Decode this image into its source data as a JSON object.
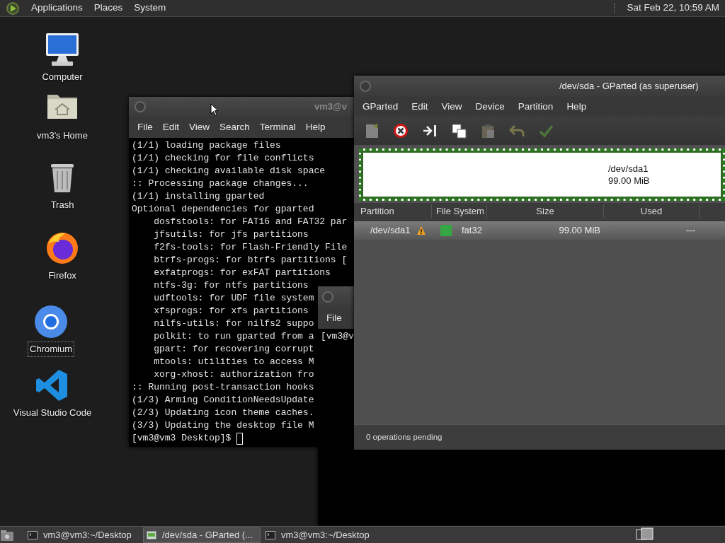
{
  "top_panel": {
    "menus": [
      "Applications",
      "Places",
      "System"
    ],
    "clock": "Sat Feb 22, 10:59 AM"
  },
  "desktop_icons": [
    {
      "label": "Computer",
      "kind": "computer",
      "selected": false
    },
    {
      "label": "vm3's Home",
      "kind": "home",
      "selected": false
    },
    {
      "label": "Trash",
      "kind": "trash",
      "selected": false
    },
    {
      "label": "Firefox",
      "kind": "firefox",
      "selected": false
    },
    {
      "label": "Chromium",
      "kind": "chromium",
      "selected": true
    },
    {
      "label": "Visual Studio Code",
      "kind": "vscode",
      "selected": false
    }
  ],
  "terminal_back": {
    "title": "vm3@v",
    "menus": [
      "File",
      "Edit",
      "View",
      "Search",
      "Terminal",
      "Help"
    ],
    "lines": [
      "(1/1) loading package files",
      "(1/1) checking for file conflicts",
      "(1/1) checking available disk space",
      ":: Processing package changes...",
      "(1/1) installing gparted",
      "Optional dependencies for gparted",
      "    dosfstools: for FAT16 and FAT32 par",
      "    jfsutils: for jfs partitions",
      "    f2fs-tools: for Flash-Friendly File",
      "    btrfs-progs: for btrfs partitions [",
      "    exfatprogs: for exFAT partitions",
      "    ntfs-3g: for ntfs partitions",
      "    udftools: for UDF file system",
      "    xfsprogs: for xfs partitions",
      "    nilfs-utils: for nilfs2 suppo",
      "    polkit: to run gparted from a",
      "    gpart: for recovering corrupt",
      "    mtools: utilities to access M",
      "    xorg-xhost: authorization fro",
      ":: Running post-transaction hooks",
      "(1/3) Arming ConditionNeedsUpdate",
      "(2/3) Updating icon theme caches.",
      "(3/3) Updating the desktop file M"
    ],
    "prompt": "[vm3@vm3 Desktop]$"
  },
  "terminal_front": {
    "menus": [
      "File"
    ],
    "lines": [
      "[vm3@v"
    ]
  },
  "gparted": {
    "title": "/dev/sda - GParted (as superuser)",
    "menus": [
      "GParted",
      "Edit",
      "View",
      "Device",
      "Partition",
      "Help"
    ],
    "toolbar": [
      {
        "kind": "new",
        "disabled": true
      },
      {
        "kind": "delete",
        "disabled": false
      },
      {
        "kind": "resize",
        "disabled": false
      },
      {
        "kind": "copy",
        "disabled": false
      },
      {
        "kind": "paste",
        "disabled": true
      },
      {
        "kind": "undo",
        "disabled": true
      },
      {
        "kind": "apply",
        "disabled": true
      }
    ],
    "disk_map": {
      "name": "/dev/sda1",
      "size": "99.00 MiB"
    },
    "table": {
      "columns": [
        "Partition",
        "File System",
        "Size",
        "Used"
      ],
      "rows": [
        {
          "partition": "/dev/sda1",
          "warning": true,
          "color": "#36a843",
          "file_system": "fat32",
          "size": "99.00 MiB",
          "used": "---",
          "selected": true
        }
      ]
    },
    "status": "0 operations pending"
  },
  "taskbar": {
    "items": [
      {
        "label": "vm3@vm3:~/Desktop",
        "kind": "terminal",
        "selected": false
      },
      {
        "label": "/dev/sda - GParted (...",
        "kind": "gparted",
        "selected": true
      },
      {
        "label": "vm3@vm3:~/Desktop",
        "kind": "terminal",
        "selected": false
      }
    ]
  }
}
